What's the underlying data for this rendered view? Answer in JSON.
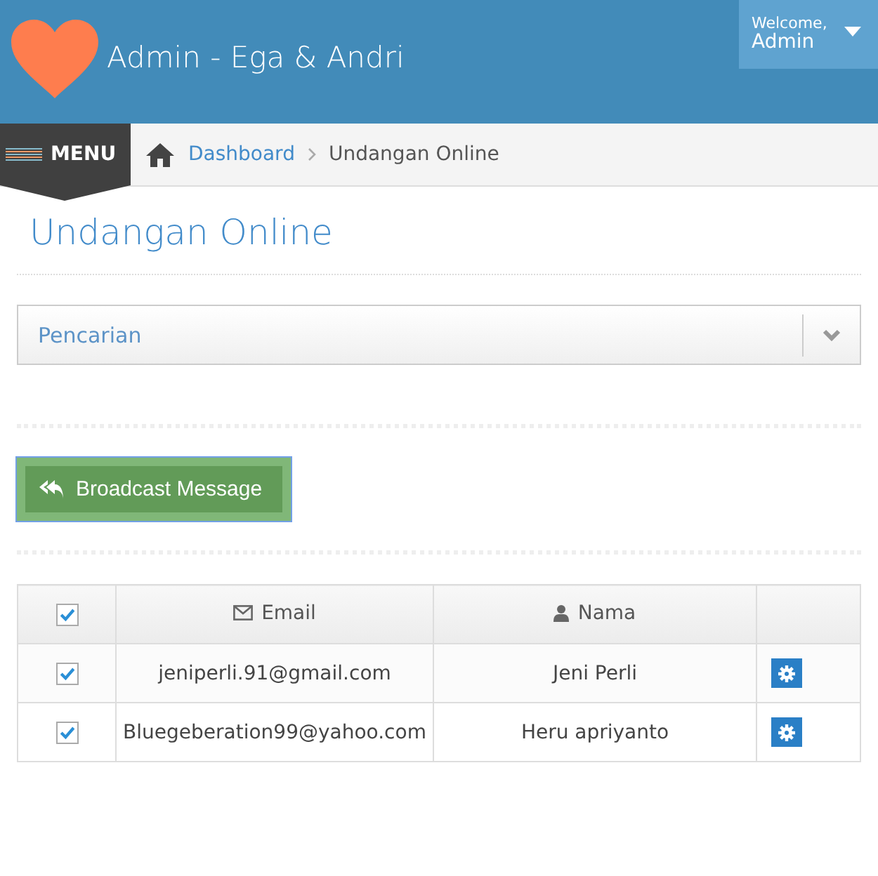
{
  "header": {
    "title": "Admin - Ega & Andri",
    "user_menu": {
      "greeting": "Welcome,",
      "name": "Admin"
    }
  },
  "menu_button": "MENU",
  "breadcrumb": [
    "Dashboard",
    "Undangan Online"
  ],
  "page_title": "Undangan Online",
  "search_panel": {
    "label": "Pencarian",
    "expanded": false
  },
  "broadcast_button": "Broadcast Message",
  "table": {
    "select_all_checked": true,
    "columns": [
      "Email",
      "Nama"
    ],
    "rows": [
      {
        "checked": true,
        "email": "jeniperli.91@gmail.com",
        "nama": "Jeni Perli"
      },
      {
        "checked": true,
        "email": "Bluegeberation99@yahoo.com",
        "nama": "Heru apriyanto"
      }
    ]
  }
}
